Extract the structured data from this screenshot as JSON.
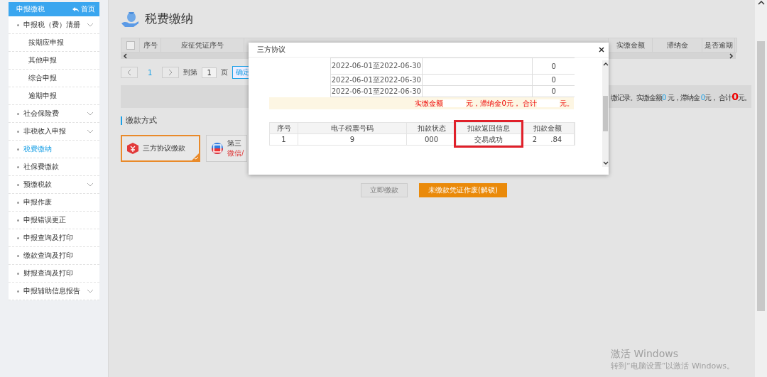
{
  "sidebar": {
    "title": "申报缴税",
    "home_link": "首页",
    "items": [
      {
        "label": "申报税（费）清册",
        "kind": "folder",
        "selected": false,
        "children": [
          {
            "label": "按期应申报",
            "selected": false
          },
          {
            "label": "其他申报",
            "selected": false
          },
          {
            "label": "综合申报",
            "selected": false
          },
          {
            "label": "逾期申报",
            "selected": false
          }
        ]
      },
      {
        "label": "社会保险费",
        "kind": "folder",
        "selected": false
      },
      {
        "label": "非税收入申报",
        "kind": "folder",
        "selected": false
      },
      {
        "label": "税费缴纳",
        "kind": "link",
        "selected": true
      },
      {
        "label": "社保费缴款",
        "kind": "link",
        "selected": false
      },
      {
        "label": "预缴税款",
        "kind": "folder",
        "selected": false
      },
      {
        "label": "申报作废",
        "kind": "link",
        "selected": false
      },
      {
        "label": "申报错误更正",
        "kind": "link",
        "selected": false
      },
      {
        "label": "申报查询及打印",
        "kind": "link",
        "selected": false
      },
      {
        "label": "缴款查询及打印",
        "kind": "link",
        "selected": false
      },
      {
        "label": "财报查询及打印",
        "kind": "link",
        "selected": false
      },
      {
        "label": "申报辅助信息报告",
        "kind": "folder",
        "selected": false
      }
    ]
  },
  "main": {
    "title": "税费缴纳",
    "table": {
      "select_all": {
        "checked": false
      },
      "columns_left": [
        "序号",
        "应征凭证序号"
      ],
      "columns_right": [
        "实缴金额",
        "滞纳金",
        "是否逾期"
      ]
    },
    "pager": {
      "page": "1",
      "goto_label": "到第",
      "goto_value": "1",
      "page_unit": "页",
      "confirm": "确定"
    },
    "summary": [
      {
        "text": "缴记录。实缴金额",
        "kind": "plain"
      },
      {
        "text": "0",
        "kind": "amount"
      },
      {
        "text": " 元，滞纳金 ",
        "kind": "plain"
      },
      {
        "text": "0",
        "kind": "amount"
      },
      {
        "text": "元， 合计",
        "kind": "plain"
      },
      {
        "text": "0",
        "kind": "total"
      },
      {
        "text": "元。",
        "kind": "plain"
      }
    ],
    "section_title": "缴款方式",
    "methods": [
      {
        "title": "三方协议缴款",
        "selected": true
      },
      {
        "title": "第三",
        "subtitle": "微信/",
        "selected": false
      }
    ],
    "buttons": [
      {
        "label": "立即缴款",
        "disabled": true
      },
      {
        "label": "未缴款凭证作废(解锁)",
        "disabled": false
      }
    ]
  },
  "dialog": {
    "title": "三方协议",
    "period_rows": [
      {
        "period": "2022-06-01至2022-06-30",
        "value": "0"
      },
      {
        "period": "2022-06-01至2022-06-30",
        "value": "0"
      },
      {
        "period": "2022-06-01至2022-06-30",
        "value": "0"
      }
    ],
    "summary": [
      "实缴金额",
      "元，滞纳金0元， 合计",
      "元。"
    ],
    "result_table": {
      "columns": [
        {
          "label": "序号",
          "highlighted": false
        },
        {
          "label": "电子税票号码",
          "highlighted": false
        },
        {
          "label": "扣款状态",
          "highlighted": false
        },
        {
          "label": "扣款返回信息",
          "highlighted": true
        },
        {
          "label": "扣款金额",
          "highlighted": false
        }
      ],
      "rows": [
        [
          "1",
          "9",
          "000",
          "交易成功",
          "2      .84"
        ]
      ]
    }
  },
  "activation_notice": {
    "title": "激活 Windows",
    "subtitle": "转到“电脑设置”以激活 Windows。"
  }
}
